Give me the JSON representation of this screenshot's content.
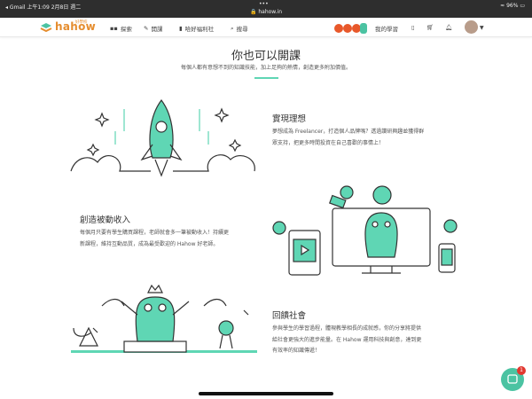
{
  "status": {
    "left": "◂ Gmail  上午1:09  2月8日 週二",
    "url": "hahow.in",
    "right": "96%"
  },
  "nav": {
    "logo": "hahow",
    "logo_small": "好學校",
    "explore": "探索",
    "teach": "開課",
    "store": "哈好福利社",
    "search": "搜尋",
    "my_learning": "我的學習"
  },
  "hero": {
    "title": "你也可以開課",
    "subtitle": "每個人都有意想不到的知識技能，加上足夠的熱情，創造更多附加價值。"
  },
  "sections": [
    {
      "title": "實現理想",
      "lines": [
        "夢想成為 Freelancer，打造個人品牌嗎？透過讚研興趣並獲得群",
        "眾支持，把更多時間投資在自己喜歡的事情上！"
      ]
    },
    {
      "title": "創造被動收入",
      "lines": [
        "每個月只要有學生購買課程，老師就會多一筆被動收入！持續更",
        "新課程，維持互動品質，成為最受歡迎的 Hahow 好老師。"
      ]
    },
    {
      "title": "回饋社會",
      "lines": [
        "參與學生的學習過程，體現教學相長的成就感，你的分享將提供",
        "給社會更強大的進步能量。在 Hahow 運用科技與創意，達到更",
        "有效率的知識傳遞！"
      ]
    }
  ],
  "chat": {
    "badge": "1"
  },
  "colors": {
    "accent": "#5fd6b4",
    "brand": "#e58d2f"
  }
}
